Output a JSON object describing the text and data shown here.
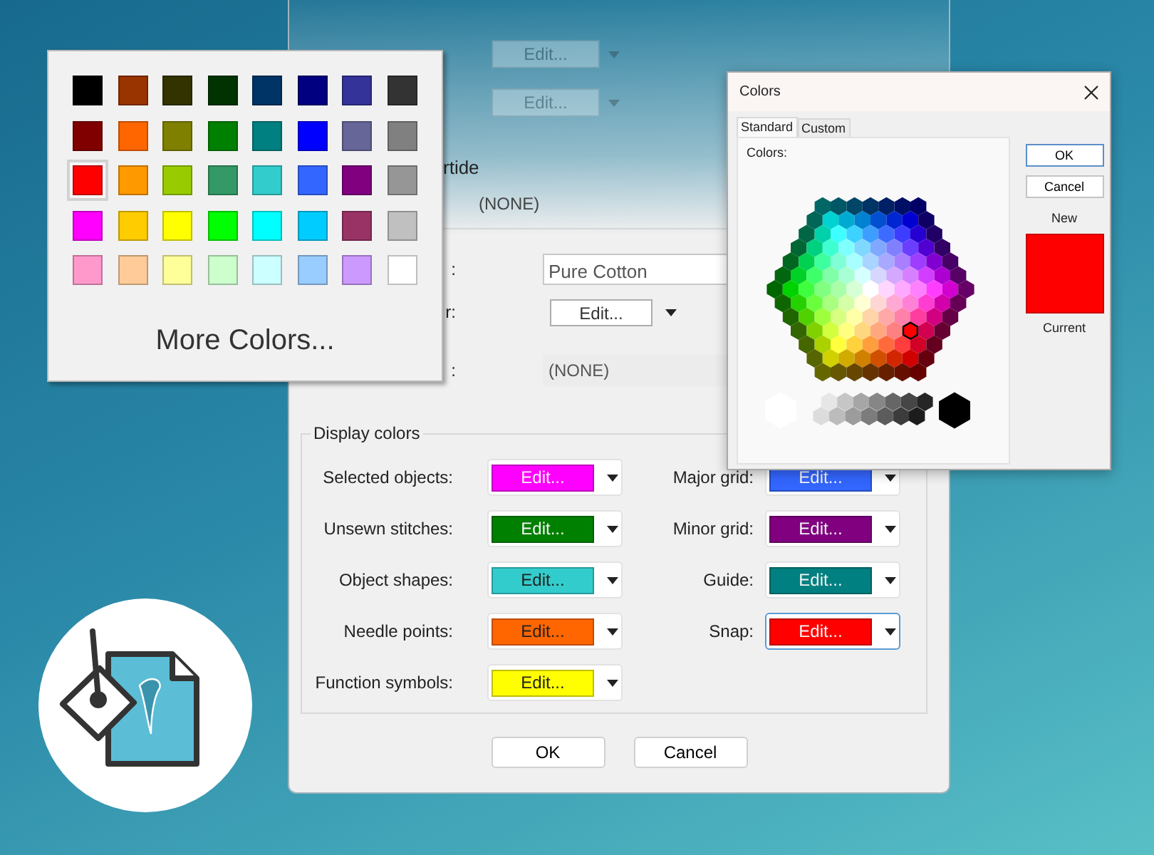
{
  "main_dialog": {
    "faded_rows": [
      {
        "button": "Edit..."
      },
      {
        "button": "Edit..."
      }
    ],
    "override": {
      "label": "rtide",
      "value": "(NONE)"
    },
    "fields": [
      {
        "kind": "text",
        "label": ":",
        "value": "Pure Cotton"
      },
      {
        "kind": "color",
        "label": "r:",
        "button": "Edit..."
      },
      {
        "kind": "readonly",
        "label": ":",
        "value": "(NONE)"
      }
    ],
    "display_colors": {
      "title": "Display colors",
      "left": [
        {
          "label": "Selected objects:",
          "button": "Edit...",
          "color": "#ff00ff",
          "focused": false
        },
        {
          "label": "Unsewn stitches:",
          "button": "Edit...",
          "color": "#008000",
          "focused": false
        },
        {
          "label": "Object shapes:",
          "button": "Edit...",
          "color": "#33cccc",
          "focused": false
        },
        {
          "label": "Needle points:",
          "button": "Edit...",
          "color": "#ff6600",
          "focused": false
        },
        {
          "label": "Function symbols:",
          "button": "Edit...",
          "color": "#ffff00",
          "focused": false
        }
      ],
      "right": [
        {
          "label": "Major grid:",
          "button": "Edit...",
          "color": "#3366ff",
          "focused": false
        },
        {
          "label": "Minor grid:",
          "button": "Edit...",
          "color": "#800080",
          "focused": false
        },
        {
          "label": "Guide:",
          "button": "Edit...",
          "color": "#008080",
          "focused": false
        },
        {
          "label": "Snap:",
          "button": "Edit...",
          "color": "#ff0000",
          "focused": true
        }
      ]
    },
    "buttons": [
      "OK",
      "Cancel"
    ]
  },
  "palette": {
    "swatches": [
      {
        "color": "#000000",
        "selected": false
      },
      {
        "color": "#993300",
        "selected": false
      },
      {
        "color": "#333300",
        "selected": false
      },
      {
        "color": "#003300",
        "selected": false
      },
      {
        "color": "#003366",
        "selected": false
      },
      {
        "color": "#000080",
        "selected": false
      },
      {
        "color": "#333399",
        "selected": false
      },
      {
        "color": "#333333",
        "selected": false
      },
      {
        "color": "#800000",
        "selected": false
      },
      {
        "color": "#ff6600",
        "selected": false
      },
      {
        "color": "#808000",
        "selected": false
      },
      {
        "color": "#008000",
        "selected": false
      },
      {
        "color": "#008080",
        "selected": false
      },
      {
        "color": "#0000ff",
        "selected": false
      },
      {
        "color": "#666699",
        "selected": false
      },
      {
        "color": "#808080",
        "selected": false
      },
      {
        "color": "#ff0000",
        "selected": true
      },
      {
        "color": "#ff9900",
        "selected": false
      },
      {
        "color": "#99cc00",
        "selected": false
      },
      {
        "color": "#339966",
        "selected": false
      },
      {
        "color": "#33cccc",
        "selected": false
      },
      {
        "color": "#3366ff",
        "selected": false
      },
      {
        "color": "#800080",
        "selected": false
      },
      {
        "color": "#969696",
        "selected": false
      },
      {
        "color": "#ff00ff",
        "selected": false
      },
      {
        "color": "#ffcc00",
        "selected": false
      },
      {
        "color": "#ffff00",
        "selected": false
      },
      {
        "color": "#00ff00",
        "selected": false
      },
      {
        "color": "#00ffff",
        "selected": false
      },
      {
        "color": "#00ccff",
        "selected": false
      },
      {
        "color": "#993366",
        "selected": false
      },
      {
        "color": "#c0c0c0",
        "selected": false
      },
      {
        "color": "#ff99cc",
        "selected": false
      },
      {
        "color": "#ffcc99",
        "selected": false
      },
      {
        "color": "#ffff99",
        "selected": false
      },
      {
        "color": "#ccffcc",
        "selected": false
      },
      {
        "color": "#ccffff",
        "selected": false
      },
      {
        "color": "#99ccff",
        "selected": false
      },
      {
        "color": "#cc99ff",
        "selected": false
      },
      {
        "color": "#ffffff",
        "selected": false
      }
    ],
    "more": "More Colors..."
  },
  "colors_dialog": {
    "title": "Colors",
    "tabs": [
      {
        "label": "Standard",
        "selected": true
      },
      {
        "label": "Custom",
        "selected": false
      }
    ],
    "colors_label": "Colors:",
    "buttons": [
      "OK",
      "Cancel"
    ],
    "new_label": "New",
    "current_label": "Current"
  }
}
